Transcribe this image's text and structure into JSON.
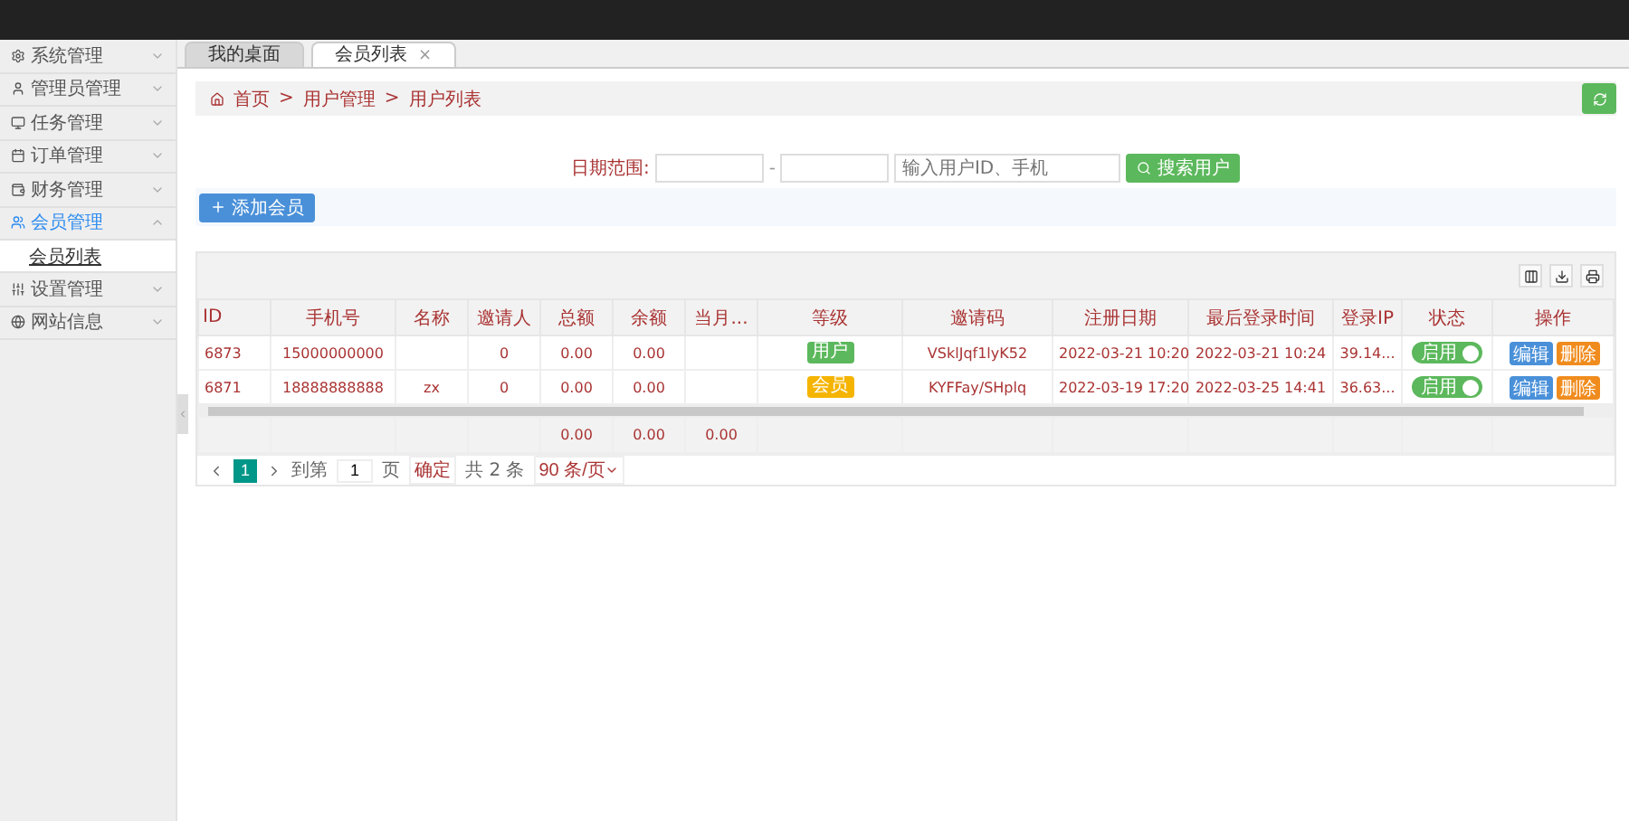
{
  "sidebar": {
    "items": [
      {
        "label": "系统管理",
        "expanded": false
      },
      {
        "label": "管理员管理",
        "expanded": false
      },
      {
        "label": "任务管理",
        "expanded": false
      },
      {
        "label": "订单管理",
        "expanded": false
      },
      {
        "label": "财务管理",
        "expanded": false
      },
      {
        "label": "会员管理",
        "expanded": true,
        "children": [
          {
            "label": "会员列表"
          }
        ]
      },
      {
        "label": "设置管理",
        "expanded": false
      },
      {
        "label": "网站信息",
        "expanded": false
      }
    ]
  },
  "tabs": [
    {
      "label": "我的桌面",
      "selected": false
    },
    {
      "label": "会员列表",
      "selected": true,
      "close": "×"
    }
  ],
  "breadcrumb": [
    "首页",
    "用户管理",
    "用户列表"
  ],
  "breadcrumb_separator": ">",
  "search": {
    "label": "日期范围:",
    "range_separator": "-",
    "placeholder": "输入用户ID、手机",
    "button": "搜索用户"
  },
  "add_button": "添加会员",
  "table": {
    "columns": [
      "ID",
      "手机号",
      "名称",
      "邀请人",
      "总额",
      "余额",
      "当月...",
      "等级",
      "邀请码",
      "注册日期",
      "最后登录时间",
      "登录IP",
      "状态",
      "操作"
    ],
    "rows": [
      {
        "id": "6873",
        "phone": "15000000000",
        "name": "",
        "inviter": "0",
        "total": "0.00",
        "balance": "0.00",
        "month": "",
        "level": {
          "label": "用户",
          "color": "#5cb85c"
        },
        "code": "VSklJqf1lyK52",
        "registered": "2022-03-21 10:20",
        "last_login": "2022-03-21 10:24",
        "ip": "39.14...",
        "status": {
          "label": "启用",
          "on": true
        },
        "actions": [
          "编辑",
          "删除"
        ]
      },
      {
        "id": "6871",
        "phone": "18888888888",
        "name": "zx",
        "inviter": "0",
        "total": "0.00",
        "balance": "0.00",
        "month": "",
        "level": {
          "label": "会员",
          "color": "#f5b400"
        },
        "code": "KYFFay/SHplq",
        "registered": "2022-03-19 17:20",
        "last_login": "2022-03-25 14:41",
        "ip": "36.63...",
        "status": {
          "label": "启用",
          "on": true
        },
        "actions": [
          "编辑",
          "删除"
        ]
      }
    ],
    "totals": [
      "0.00",
      "0.00",
      "0.00"
    ]
  },
  "pagination": {
    "pages": [
      {
        "label": "1",
        "selected": true
      }
    ],
    "goto_label": "到第",
    "goto_value": "1",
    "page_unit": "页",
    "confirm": "确定",
    "total": "共 2 条",
    "page_size": "90 条/页"
  }
}
